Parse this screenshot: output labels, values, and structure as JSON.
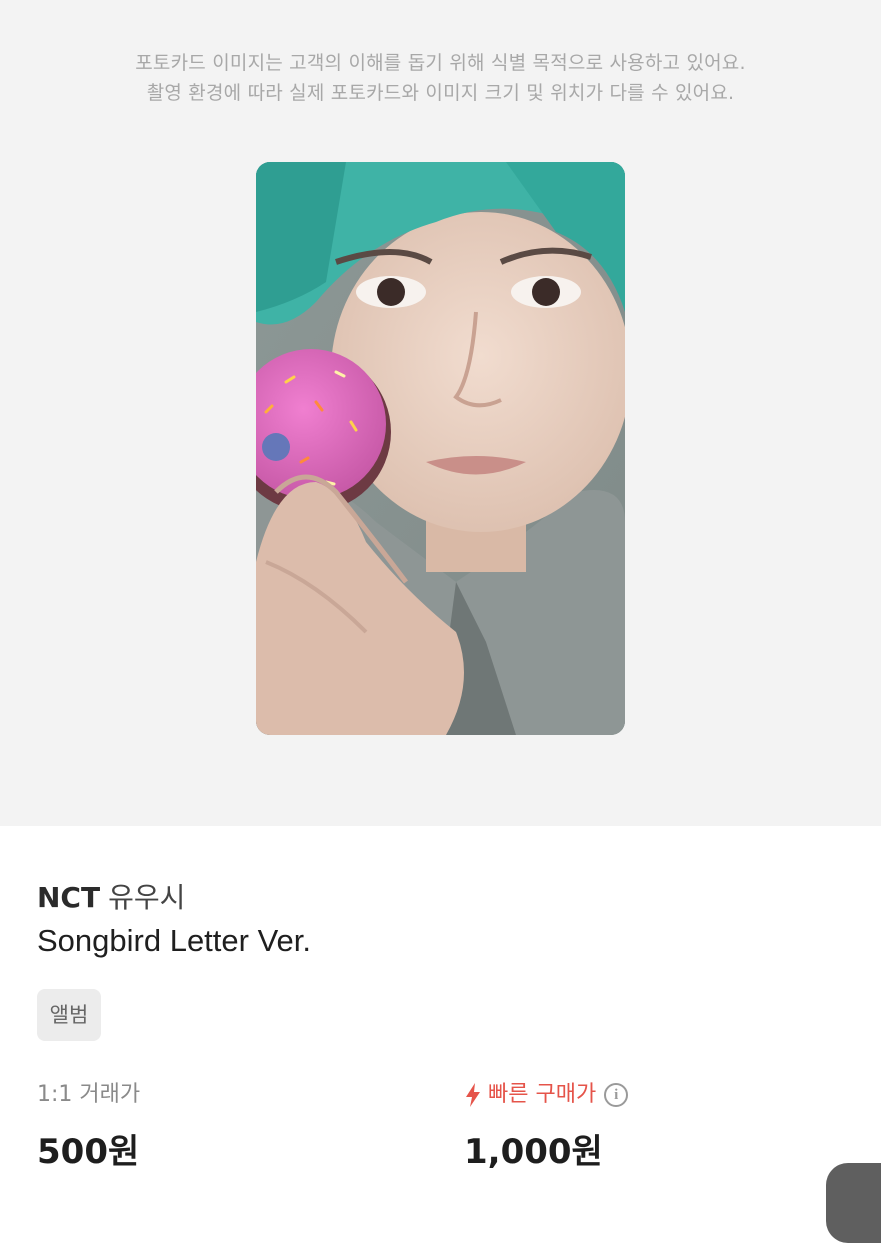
{
  "notice": {
    "line1": "포토카드 이미지는 고객의 이해를 돕기 위해 식별 목적으로 사용하고 있어요.",
    "line2": "촬영 환경에 따라 실제 포토카드와 이미지 크기 및 위치가 다를 수 있어요."
  },
  "product": {
    "group": "NCT",
    "member": "유우시",
    "album_version": "Songbird Letter Ver.",
    "tag": "앨범"
  },
  "prices": {
    "trade_label": "1:1 거래가",
    "trade_value": "500원",
    "quick_label": "빠른 구매가",
    "quick_value": "1,000원"
  },
  "colors": {
    "accent_red": "#e5544a",
    "background_gray": "#f3f3f3"
  },
  "icons": {
    "quick": "lightning-bolt-icon",
    "info": "info-circle-icon"
  }
}
